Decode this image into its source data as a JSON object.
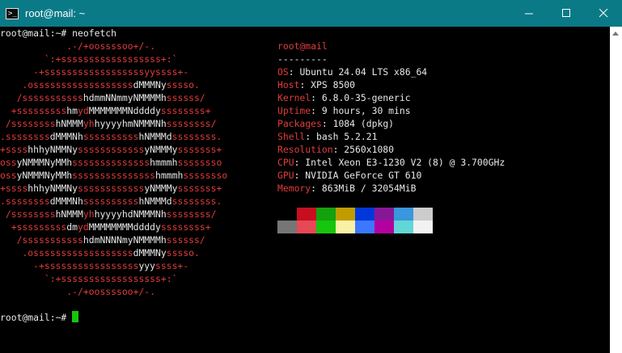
{
  "window": {
    "title": "root@mail: ~"
  },
  "terminal": {
    "prompt1": "root@mail:~# neofetch",
    "prompt2": "root@mail:~# ",
    "logo": [
      [
        [
          "r",
          "            .-/+oossssoo+/-."
        ]
      ],
      [
        [
          "r",
          "        `:+ssssssssssssssssss+:`"
        ]
      ],
      [
        [
          "r",
          "      -+ssssssssssssssssssyyssss+-"
        ]
      ],
      [
        [
          "r",
          "    .ossssssssssssssssss"
        ],
        [
          "w",
          "dMMMNy"
        ],
        [
          "r",
          "sssso."
        ]
      ],
      [
        [
          "r",
          "   /sssssssssss"
        ],
        [
          "w",
          "hdmmNNmmyNMMMMh"
        ],
        [
          "r",
          "ssssss/"
        ]
      ],
      [
        [
          "r",
          "  +sssssssss"
        ],
        [
          "w",
          "hm"
        ],
        [
          "r",
          "yd"
        ],
        [
          "w",
          "MMMMMMMNddddy"
        ],
        [
          "r",
          "ssssssss+"
        ]
      ],
      [
        [
          "r",
          " /ssssssss"
        ],
        [
          "w",
          "hNMMM"
        ],
        [
          "r",
          "yh"
        ],
        [
          "w",
          "hyyyyhmNMMMNh"
        ],
        [
          "r",
          "ssssssss/"
        ]
      ],
      [
        [
          "r",
          ".ssssssss"
        ],
        [
          "w",
          "dMMMNh"
        ],
        [
          "r",
          "ssssssssss"
        ],
        [
          "w",
          "hNMMMd"
        ],
        [
          "r",
          "ssssssss."
        ]
      ],
      [
        [
          "r",
          "+ssss"
        ],
        [
          "w",
          "hhhyNMMNy"
        ],
        [
          "r",
          "ssssssssssss"
        ],
        [
          "w",
          "yNMMMy"
        ],
        [
          "r",
          "sssssss+"
        ]
      ],
      [
        [
          "r",
          "oss"
        ],
        [
          "w",
          "yNMMMNyMMh"
        ],
        [
          "r",
          "ssssssssssssss"
        ],
        [
          "w",
          "hmmmh"
        ],
        [
          "r",
          "ssssssso"
        ]
      ],
      [
        [
          "r",
          "oss"
        ],
        [
          "w",
          "yNMMMNyMMh"
        ],
        [
          "r",
          "sssssssssssssss"
        ],
        [
          "w",
          "hmmmh"
        ],
        [
          "r",
          "ssssssso"
        ]
      ],
      [
        [
          "r",
          "+ssss"
        ],
        [
          "w",
          "hhhyNMMNy"
        ],
        [
          "r",
          "ssssssssssss"
        ],
        [
          "w",
          "yNMMMy"
        ],
        [
          "r",
          "sssssss+"
        ]
      ],
      [
        [
          "r",
          ".ssssssss"
        ],
        [
          "w",
          "dMMMNh"
        ],
        [
          "r",
          "ssssssssss"
        ],
        [
          "w",
          "hNMMMd"
        ],
        [
          "r",
          "ssssssss."
        ]
      ],
      [
        [
          "r",
          " /ssssssss"
        ],
        [
          "w",
          "hNMMM"
        ],
        [
          "r",
          "yh"
        ],
        [
          "w",
          "hyyyyhdNMMMNh"
        ],
        [
          "r",
          "ssssssss/"
        ]
      ],
      [
        [
          "r",
          "  +sssssssss"
        ],
        [
          "w",
          "dm"
        ],
        [
          "r",
          "yd"
        ],
        [
          "w",
          "MMMMMMMMddddy"
        ],
        [
          "r",
          "ssssssss+"
        ]
      ],
      [
        [
          "r",
          "   /sssssssssss"
        ],
        [
          "w",
          "hdmNNNNmyNMMMMh"
        ],
        [
          "r",
          "ssssss/"
        ]
      ],
      [
        [
          "r",
          "    .ossssssssssssssssss"
        ],
        [
          "w",
          "dMMMNy"
        ],
        [
          "r",
          "sssso."
        ]
      ],
      [
        [
          "r",
          "      -+sssssssssssssssss"
        ],
        [
          "w",
          "yyy"
        ],
        [
          "r",
          "ssss+-"
        ]
      ],
      [
        [
          "r",
          "        `:+ssssssssssssssssss+:`"
        ]
      ],
      [
        [
          "r",
          "            .-/+oossssoo+/-."
        ]
      ]
    ],
    "user_host": "root@mail",
    "separator": "---------",
    "info": [
      {
        "key": "OS",
        "value": "Ubuntu 24.04 LTS x86_64"
      },
      {
        "key": "Host",
        "value": "XPS 8500"
      },
      {
        "key": "Kernel",
        "value": "6.8.0-35-generic"
      },
      {
        "key": "Uptime",
        "value": "9 hours, 30 mins"
      },
      {
        "key": "Packages",
        "value": "1084 (dpkg)"
      },
      {
        "key": "Shell",
        "value": "bash 5.2.21"
      },
      {
        "key": "Resolution",
        "value": "2560x1080"
      },
      {
        "key": "CPU",
        "value": "Intel Xeon E3-1230 V2 (8) @ 3.700GHz"
      },
      {
        "key": "GPU",
        "value": "NVIDIA GeForce GT 610"
      },
      {
        "key": "Memory",
        "value": "863MiB / 32054MiB"
      }
    ],
    "palette_row1": [
      "#000000",
      "#c50f1f",
      "#13a10e",
      "#c19c00",
      "#0037da",
      "#881798",
      "#3a96dd",
      "#cccccc"
    ],
    "palette_row2": [
      "#767676",
      "#e74856",
      "#16c60c",
      "#f9f1a5",
      "#3b78ff",
      "#b4009e",
      "#61d6d6",
      "#f2f2f2"
    ]
  }
}
